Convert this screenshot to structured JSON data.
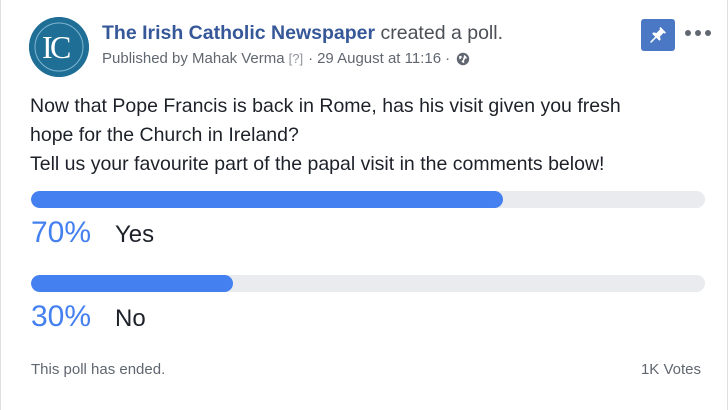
{
  "post": {
    "page_name": "The Irish Catholic Newspaper",
    "action_text": " created a poll.",
    "published_by": "Published by Mahak Verma",
    "help_marker": "[?]",
    "separator1": "·",
    "date": "29 August at 11:16",
    "separator2": "·",
    "avatar_icon": "irish-catholic-logo",
    "pin_icon": "pin-icon",
    "more_icon": "ellipsis-icon",
    "pin_color": "#4a78c4"
  },
  "poll": {
    "question_lines": [
      "Now that Pope Francis is back in Rome, has his visit given you fresh",
      "hope for the Church in Ireland?",
      "Tell us your favourite part of the papal visit in the comments below!"
    ],
    "options": [
      {
        "percent_label": "70%",
        "label": "Yes",
        "fraction": 0.7
      },
      {
        "percent_label": "30%",
        "label": "No",
        "fraction": 0.3
      }
    ],
    "bar_color": "#4480f0",
    "track_color": "#e9ebee",
    "status_text": "This poll has ended.",
    "votes_text": "1K Votes"
  }
}
